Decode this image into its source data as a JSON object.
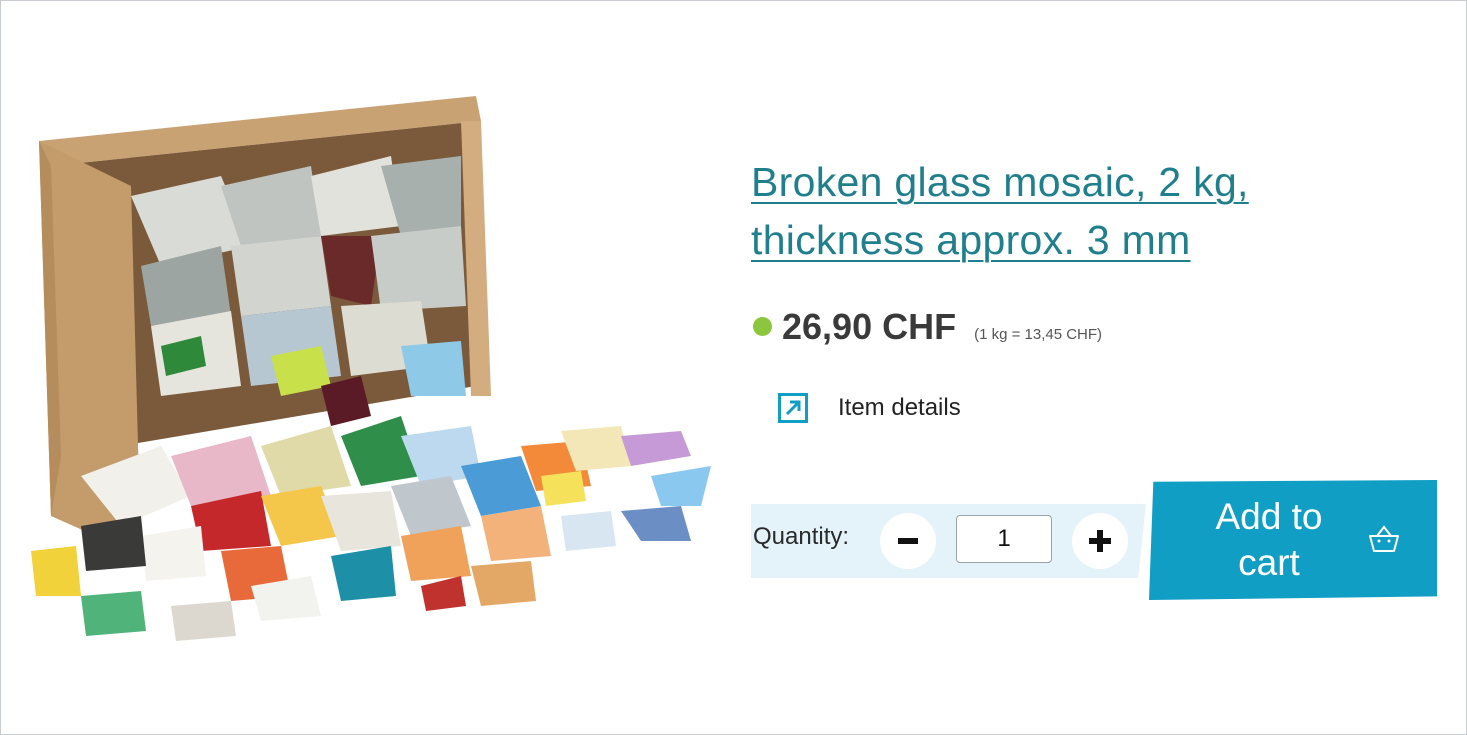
{
  "product": {
    "title": "Broken glass mosaic, 2 kg, thickness approx. 3 mm",
    "image_alt": "Box of broken glass mosaic pieces",
    "price": "26,90 CHF",
    "unit_price": "(1 kg = 13,45 CHF)",
    "stock_color": "#8cc63f"
  },
  "details": {
    "label": "Item details",
    "icon": "external-arrow-icon"
  },
  "quantity": {
    "label": "Quantity:",
    "value": "1",
    "decrease_icon": "minus-icon",
    "increase_icon": "plus-icon"
  },
  "cart": {
    "label": "Add to cart",
    "icon": "basket-icon",
    "color": "#119ec4"
  },
  "colors": {
    "title": "#1f7f8c",
    "accent": "#119ec4",
    "band": "#e4f3f9"
  }
}
